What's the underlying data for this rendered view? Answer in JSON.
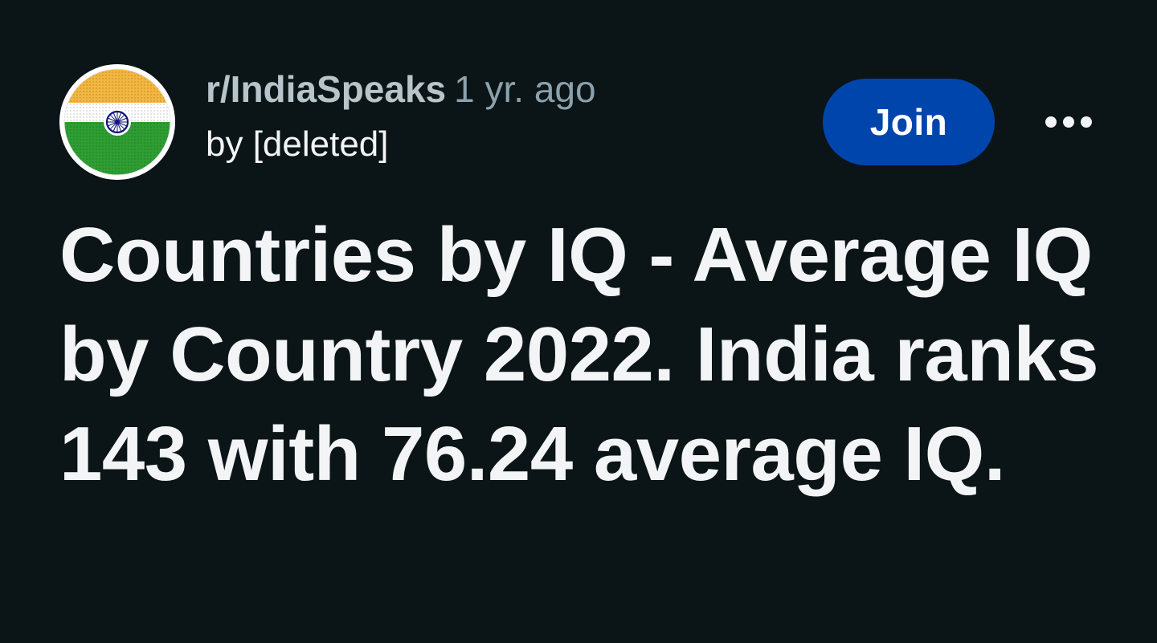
{
  "post": {
    "subreddit": "r/IndiaSpeaks",
    "time_ago": "1 yr. ago",
    "author": "by [deleted]",
    "join_label": "Join",
    "more_icon": "more-horizontal-icon",
    "avatar_icon": "india-flag-icon",
    "title": "Countries by IQ - Average IQ by Country 2022. India ranks 143 with 76.24 average IQ."
  },
  "colors": {
    "background": "#0b1416",
    "join_button": "#0045ac",
    "flag_saffron": "#f3b63f",
    "flag_green": "#2e9e33",
    "chakra_navy": "#10157a"
  }
}
